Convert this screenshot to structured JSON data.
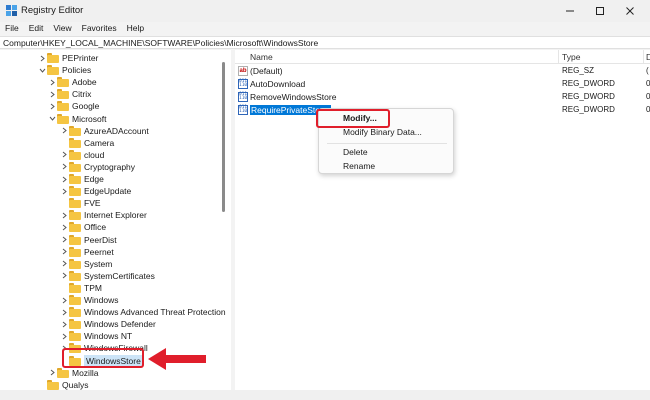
{
  "window": {
    "title": "Registry Editor",
    "controls": {
      "minimize": "minimize",
      "maximize": "maximize",
      "close": "close"
    }
  },
  "menu": [
    "File",
    "Edit",
    "View",
    "Favorites",
    "Help"
  ],
  "address": "Computer\\HKEY_LOCAL_MACHINE\\SOFTWARE\\Policies\\Microsoft\\WindowsStore",
  "tree": {
    "items": [
      {
        "label": "PEPrinter",
        "expanded": false
      },
      {
        "label": "Policies",
        "expanded": true
      },
      {
        "label": "Adobe",
        "expanded": false
      },
      {
        "label": "Citrix",
        "expanded": false
      },
      {
        "label": "Google",
        "expanded": false
      },
      {
        "label": "Microsoft",
        "expanded": true
      },
      {
        "label": "AzureADAccount",
        "expanded": false
      },
      {
        "label": "Camera",
        "expanded": null
      },
      {
        "label": "cloud",
        "expanded": false
      },
      {
        "label": "Cryptography",
        "expanded": false
      },
      {
        "label": "Edge",
        "expanded": false
      },
      {
        "label": "EdgeUpdate",
        "expanded": false
      },
      {
        "label": "FVE",
        "expanded": null
      },
      {
        "label": "Internet Explorer",
        "expanded": false
      },
      {
        "label": "Office",
        "expanded": false
      },
      {
        "label": "PeerDist",
        "expanded": false
      },
      {
        "label": "Peernet",
        "expanded": false
      },
      {
        "label": "System",
        "expanded": false
      },
      {
        "label": "SystemCertificates",
        "expanded": false
      },
      {
        "label": "TPM",
        "expanded": null
      },
      {
        "label": "Windows",
        "expanded": false
      },
      {
        "label": "Windows Advanced Threat Protection",
        "expanded": false
      },
      {
        "label": "Windows Defender",
        "expanded": false
      },
      {
        "label": "Windows NT",
        "expanded": false
      },
      {
        "label": "WindowsFirewall",
        "expanded": false
      },
      {
        "label": "WindowsStore",
        "expanded": null,
        "selected": true
      },
      {
        "label": "Mozilla",
        "expanded": false
      },
      {
        "label": "Qualys",
        "expanded": null
      }
    ]
  },
  "list": {
    "columns": [
      "Name",
      "Type",
      "D"
    ],
    "rows": [
      {
        "name": "(Default)",
        "type": "REG_SZ",
        "data": "(",
        "icon": "string-value-icon"
      },
      {
        "name": "AutoDownload",
        "type": "REG_DWORD",
        "data": "0",
        "icon": "dword-value-icon"
      },
      {
        "name": "RemoveWindowsStore",
        "type": "REG_DWORD",
        "data": "0",
        "icon": "dword-value-icon"
      },
      {
        "name": "RequirePrivateStore",
        "type": "REG_DWORD",
        "data": "0",
        "icon": "dword-value-icon",
        "selected": true
      }
    ]
  },
  "context_menu": {
    "items": [
      "Modify...",
      "Modify Binary Data...",
      "Delete",
      "Rename"
    ]
  },
  "colors": {
    "highlight": "#e01e2b",
    "selection": "#0078d7",
    "folder": "#f5c542"
  }
}
